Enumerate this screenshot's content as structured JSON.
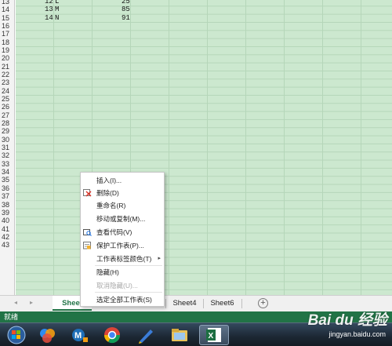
{
  "sheet": {
    "rows": [
      "13",
      "14",
      "15",
      "16",
      "17",
      "18",
      "19",
      "20",
      "21",
      "22",
      "23",
      "24",
      "25",
      "26",
      "27",
      "28",
      "29",
      "30",
      "31",
      "32",
      "33",
      "34",
      "35",
      "36",
      "37",
      "38",
      "39",
      "40",
      "41",
      "42",
      "43"
    ],
    "data_rows": [
      {
        "num": "12",
        "letter": "L",
        "value": "25"
      },
      {
        "num": "13",
        "letter": "M",
        "value": "85"
      },
      {
        "num": "14",
        "letter": "N",
        "value": "91"
      }
    ]
  },
  "context_menu": {
    "items": [
      {
        "label": "插入(I)...",
        "icon": "",
        "disabled": false
      },
      {
        "label": "删除(D)",
        "icon": "delete-sheet-icon",
        "disabled": false
      },
      {
        "label": "重命名(R)",
        "icon": "",
        "disabled": false
      },
      {
        "label": "移动或复制(M)...",
        "icon": "",
        "disabled": false
      },
      {
        "label": "查看代码(V)",
        "icon": "view-code-icon",
        "disabled": false
      },
      {
        "label": "保护工作表(P)...",
        "icon": "protect-sheet-icon",
        "disabled": false
      },
      {
        "label": "工作表标签颜色(T)",
        "icon": "",
        "disabled": false,
        "submenu": true
      },
      {
        "label": "隐藏(H)",
        "icon": "",
        "disabled": false
      },
      {
        "label": "取消隐藏(U)...",
        "icon": "",
        "disabled": true
      },
      {
        "label": "选定全部工作表(S)",
        "icon": "",
        "disabled": false
      }
    ],
    "submenu_arrow": "▸"
  },
  "tabs": {
    "nav_prev": "◂",
    "nav_next": "▸",
    "items": [
      {
        "label": "Sheet",
        "active": true
      },
      {
        "label": "Sheet4",
        "active": false
      },
      {
        "label": "Sheet6",
        "active": false
      }
    ],
    "add_label": "+"
  },
  "status": {
    "text": "就绪"
  },
  "taskbar": {
    "apps": [
      "start-orb-icon",
      "colorful-app-icon",
      "media-app-icon",
      "chrome-icon",
      "pen-app-icon",
      "file-explorer-icon",
      "excel-icon"
    ],
    "active": "excel-icon"
  },
  "watermark": {
    "logo": "Bai du 经验",
    "url": "jingyan.baidu.com"
  },
  "colors": {
    "grid_bg": "#cce8cf",
    "excel_green": "#217346",
    "taskbar_bg": "#1c2733"
  }
}
